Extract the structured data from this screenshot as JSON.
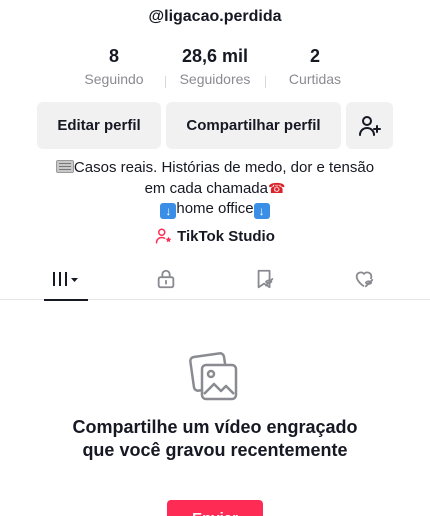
{
  "profile": {
    "username": "@ligacao.perdida"
  },
  "stats": [
    {
      "value": "8",
      "label": "Seguindo"
    },
    {
      "value": "28,6 mil",
      "label": "Seguidores"
    },
    {
      "value": "2",
      "label": "Curtidas"
    }
  ],
  "actions": {
    "edit_label": "Editar perfil",
    "share_label": "Compartilhar perfil",
    "add_friend_icon": "add-user-icon"
  },
  "bio": {
    "line1": "Casos reais. Histórias de medo, dor e tensão",
    "line2": "em cada chamada",
    "line3": "home office",
    "icons": [
      "newspaper-icon",
      "telephone-icon",
      "down-arrow-icon"
    ]
  },
  "studio": {
    "label": "TikTok Studio",
    "icon": "person-star-icon",
    "icon_color": "#fe2c55"
  },
  "tabs": [
    {
      "name": "videos",
      "icon": "grid-bars-icon",
      "active": true
    },
    {
      "name": "private",
      "icon": "lock-icon",
      "active": false
    },
    {
      "name": "reposts",
      "icon": "repost-hidden-icon",
      "active": false
    },
    {
      "name": "liked",
      "icon": "heart-hidden-icon",
      "active": false
    }
  ],
  "empty_state": {
    "icon": "photos-icon",
    "message": "Compartilhe um vídeo engraçado que você gravou recentemente",
    "upload_label": "Enviar"
  },
  "colors": {
    "accent": "#fe2c55",
    "text": "#161823",
    "secondary_text": "#8a8b91",
    "button_bg": "#f1f1f2"
  }
}
